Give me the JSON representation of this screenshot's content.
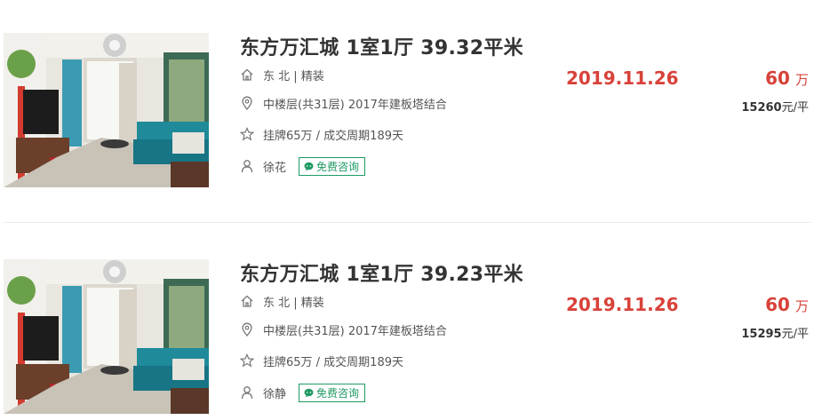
{
  "listings": [
    {
      "title": "东方万汇城 1室1厅 39.32平米",
      "orientation_decoration": "东 北 | 精装",
      "floor_year": "中楼层(共31层) 2017年建板塔结合",
      "listing_cycle": "挂牌65万 / 成交周期189天",
      "agent": "徐花",
      "consult_label": "免费咨询",
      "deal_date": "2019.11.26",
      "total_price": "60",
      "total_price_unit": "万",
      "unit_price": "15260",
      "unit_price_suffix": "元/平"
    },
    {
      "title": "东方万汇城 1室1厅 39.23平米",
      "orientation_decoration": "东 北 | 精装",
      "floor_year": "中楼层(共31层) 2017年建板塔结合",
      "listing_cycle": "挂牌65万 / 成交周期189天",
      "agent": "徐静",
      "consult_label": "免费咨询",
      "deal_date": "2019.11.26",
      "total_price": "60",
      "total_price_unit": "万",
      "unit_price": "15295",
      "unit_price_suffix": "元/平"
    }
  ],
  "colors": {
    "price_red": "#d8423a",
    "consult_green": "#1f9a62",
    "text_dark": "#333333",
    "text_gray": "#555555"
  },
  "icons": {
    "orientation": "house-icon",
    "floor": "location-pin-icon",
    "listing": "star-icon",
    "agent": "person-icon",
    "consult": "wechat-chat-icon"
  }
}
